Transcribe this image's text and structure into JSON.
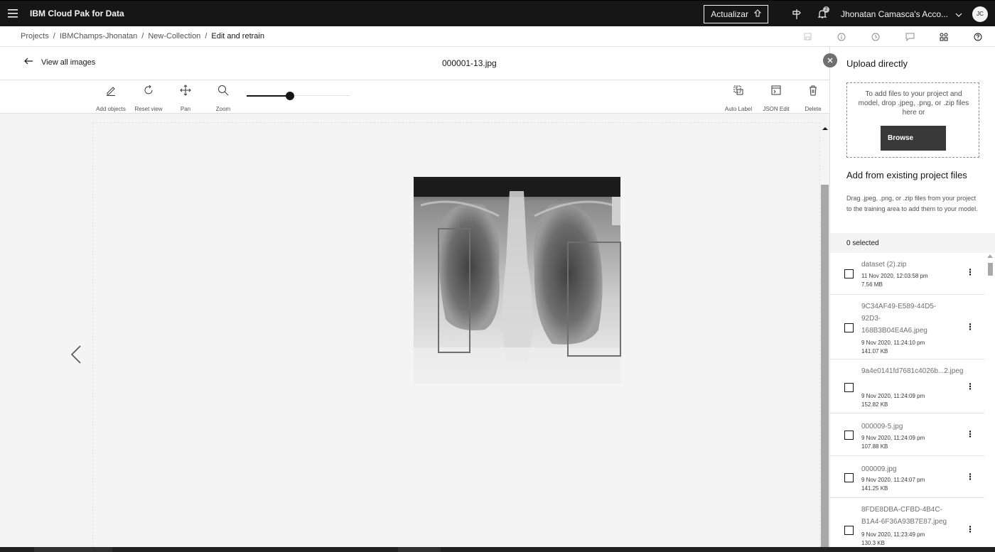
{
  "header": {
    "brand": "IBM Cloud Pak for Data",
    "update_label": "Actualizar",
    "notification_count": "2",
    "account_name": "Jhonatan Camasca's Acco...",
    "avatar_initials": "JC"
  },
  "breadcrumb": {
    "items": [
      "Projects",
      "IBMChamps-Jhonatan",
      "New-Collection"
    ],
    "current": "Edit and retrain"
  },
  "title_row": {
    "back_label": "View all images",
    "image_name": "000001-13.jpg"
  },
  "toolbar": {
    "tools": [
      {
        "label": "Add objects",
        "icon": "pencil-icon"
      },
      {
        "label": "Reset view",
        "icon": "reset-icon"
      },
      {
        "label": "Pan",
        "icon": "move-icon"
      },
      {
        "label": "Zoom",
        "icon": "zoom-icon"
      }
    ],
    "zoom_level": 0.42,
    "right_tools": [
      {
        "label": "Auto Label",
        "icon": "auto-label-icon"
      },
      {
        "label": "JSON Edit",
        "icon": "json-edit-icon"
      },
      {
        "label": "Delete",
        "icon": "trash-icon"
      }
    ]
  },
  "panel": {
    "upload_title": "Upload directly",
    "dropzone_text": "To add files to your project and model, drop .jpeg, .png, or .zip files here or",
    "browse_label": "Browse",
    "existing_title": "Add from existing project files",
    "existing_help": "Drag .jpeg, .png, or .zip files from your project to the training area to add them to your model.",
    "selected_label": "0 selected",
    "files": [
      {
        "name": "dataset (2).zip",
        "date": "11 Nov 2020, 12:03:58 pm",
        "size": "7.56 MB"
      },
      {
        "name": "9C34AF49-E589-44D5-92D3-168B3B04E4A6.jpeg",
        "date": "9 Nov 2020, 11:24:10 pm",
        "size": "141.07 KB"
      },
      {
        "name": "9a4e0141fd7681c4026b...2.jpeg",
        "date": "9 Nov 2020, 11:24:09 pm",
        "size": "152.82 KB"
      },
      {
        "name": "000009-5.jpg",
        "date": "9 Nov 2020, 11:24:09 pm",
        "size": "107.88 KB"
      },
      {
        "name": "000009.jpg",
        "date": "9 Nov 2020, 11:24:07 pm",
        "size": "141.25 KB"
      },
      {
        "name": "8FDE8DBA-CFBD-4B4C-B1A4-6F36A93B7E87.jpeg",
        "date": "9 Nov 2020, 11:23:49 pm",
        "size": "130.3 KB"
      }
    ]
  },
  "colors": {
    "header_bg": "#161616",
    "primary_button": "#393939",
    "canvas_bg": "#f4f4f4"
  }
}
